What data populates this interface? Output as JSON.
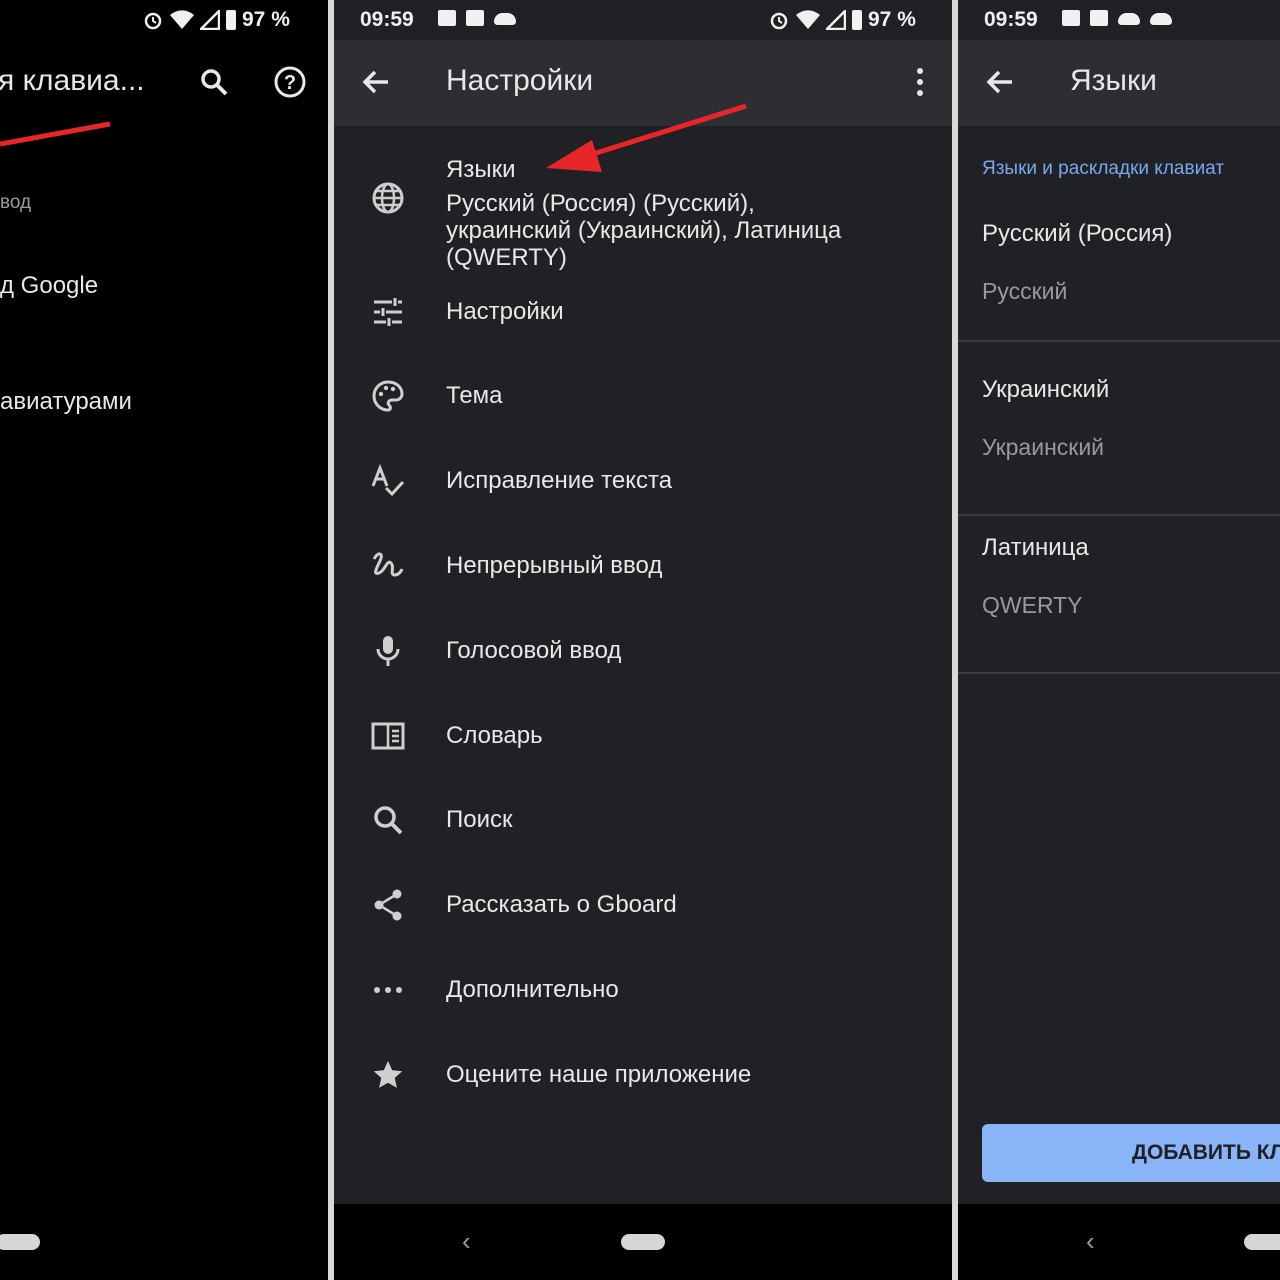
{
  "status_bar": {
    "time": "09:59",
    "battery": "97 %"
  },
  "left_panel": {
    "title": "я клавиа...",
    "items": [
      {
        "label": "вод"
      },
      {
        "label": "д Google"
      },
      {
        "label": "авиатурами"
      }
    ]
  },
  "mid_panel": {
    "title": "Настройки",
    "items": [
      {
        "label": "Языки",
        "sub": "Русский (Россия) (Русский), украинский (Украинский), Латиница (QWERTY)"
      },
      {
        "label": "Настройки"
      },
      {
        "label": "Тема"
      },
      {
        "label": "Исправление текста"
      },
      {
        "label": "Непрерывный ввод"
      },
      {
        "label": "Голосовой ввод"
      },
      {
        "label": "Словарь"
      },
      {
        "label": "Поиск"
      },
      {
        "label": "Рассказать о Gboard"
      },
      {
        "label": "Дополнительно"
      },
      {
        "label": "Оцените наше приложение"
      }
    ],
    "nav_back": "‹"
  },
  "right_panel": {
    "title": "Языки",
    "section": "Языки и раскладки клавиат",
    "languages": [
      {
        "name": "Русский (Россия)",
        "layout": "Русский"
      },
      {
        "name": "Украинский",
        "layout": "Украинский"
      },
      {
        "name": "Латиница",
        "layout": "QWERTY"
      }
    ],
    "add_button": "ДОБАВИТЬ КЛ",
    "nav_back": "‹"
  },
  "colors": {
    "accent": "#8ab4f8",
    "annotation_arrow": "#e8262a",
    "background": "#202124"
  }
}
